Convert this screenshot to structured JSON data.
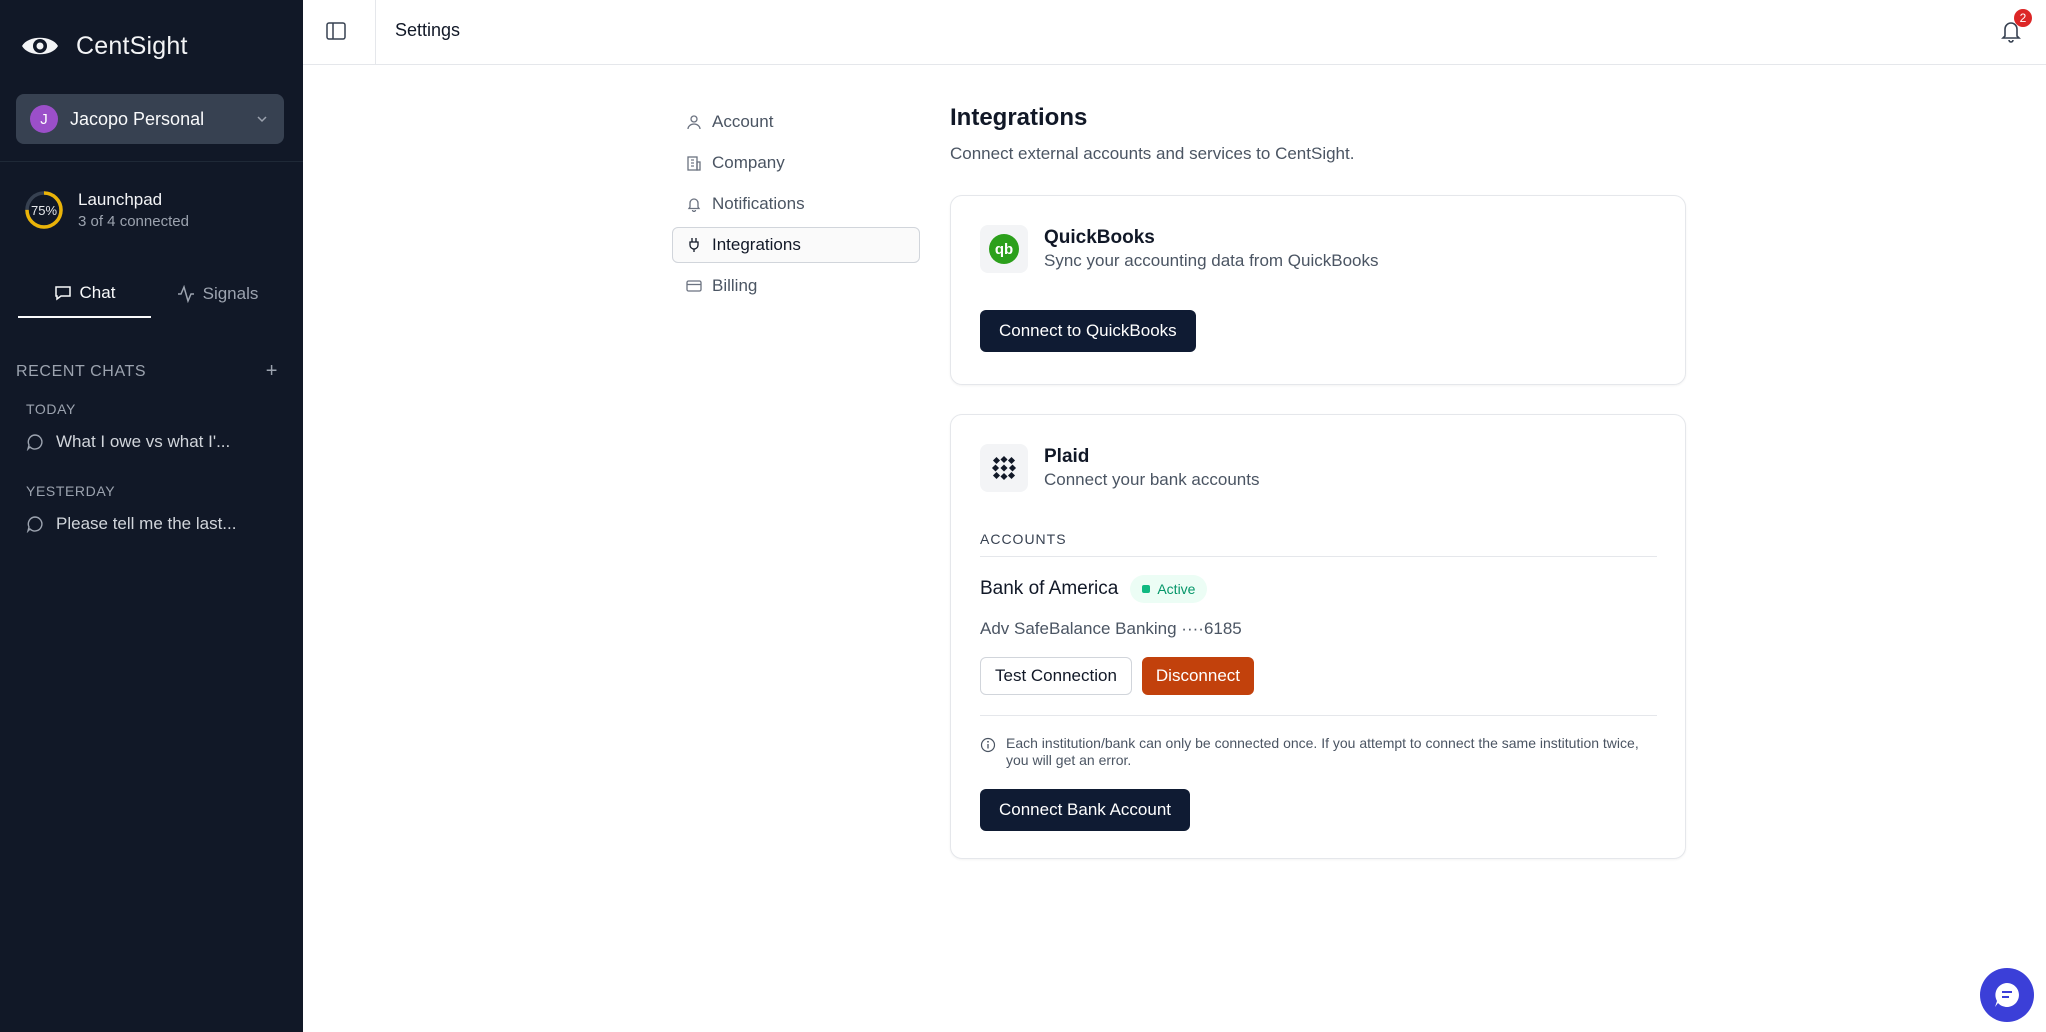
{
  "app": {
    "name": "CentSight"
  },
  "workspace": {
    "initial": "J",
    "name": "Jacopo Personal"
  },
  "launchpad": {
    "progress_label": "75%",
    "progress": 0.75,
    "title": "Launchpad",
    "subtitle": "3 of 4 connected"
  },
  "sidebar_tabs": [
    {
      "label": "Chat"
    },
    {
      "label": "Signals"
    }
  ],
  "recent_chats": {
    "heading": "RECENT CHATS",
    "groups": [
      {
        "label": "TODAY",
        "items": [
          {
            "title": "What I owe vs what I'..."
          }
        ]
      },
      {
        "label": "YESTERDAY",
        "items": [
          {
            "title": "Please tell me the last..."
          }
        ]
      }
    ]
  },
  "topbar": {
    "title": "Settings",
    "notification_count": "2"
  },
  "settings_nav": [
    {
      "label": "Account",
      "icon": "user-icon"
    },
    {
      "label": "Company",
      "icon": "building-icon"
    },
    {
      "label": "Notifications",
      "icon": "bell-icon"
    },
    {
      "label": "Integrations",
      "icon": "plug-icon",
      "active": true
    },
    {
      "label": "Billing",
      "icon": "card-icon"
    }
  ],
  "integrations": {
    "title": "Integrations",
    "subtitle": "Connect external accounts and services to CentSight.",
    "quickbooks": {
      "name": "QuickBooks",
      "description": "Sync your accounting data from QuickBooks",
      "connect_label": "Connect to QuickBooks",
      "brand_color": "#2ca01c"
    },
    "plaid": {
      "name": "Plaid",
      "description": "Connect your bank accounts",
      "accounts_label": "ACCOUNTS",
      "bank": {
        "name": "Bank of America",
        "status": "Active",
        "account_line": "Adv SafeBalance Banking ····6185",
        "test_label": "Test Connection",
        "disconnect_label": "Disconnect"
      },
      "note": "Each institution/bank can only be connected once. If you attempt to connect the same institution twice, you will get an error.",
      "connect_label": "Connect Bank Account"
    }
  },
  "colors": {
    "sidebar": "#111827",
    "primary_button": "#0f1b33",
    "danger": "#c2410c",
    "success": "#10b981",
    "fab": "#3b3fd8"
  }
}
